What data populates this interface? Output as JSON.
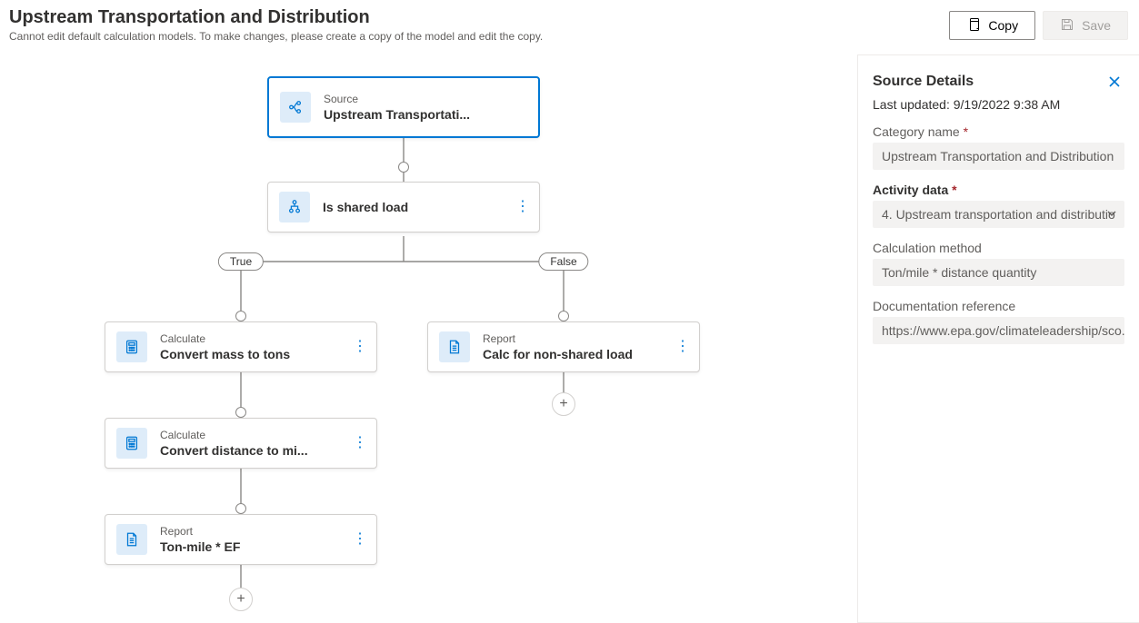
{
  "header": {
    "title": "Upstream Transportation and Distribution",
    "subtitle": "Cannot edit default calculation models. To make changes, please create a copy of the model and edit the copy.",
    "copy_label": "Copy",
    "save_label": "Save"
  },
  "flow": {
    "source": {
      "eyebrow": "Source",
      "label": "Upstream Transportati..."
    },
    "condition": {
      "label": "Is shared load"
    },
    "branch_true": "True",
    "branch_false": "False",
    "true_steps": [
      {
        "eyebrow": "Calculate",
        "label": "Convert mass to tons",
        "icon": "calculator"
      },
      {
        "eyebrow": "Calculate",
        "label": "Convert distance to mi...",
        "icon": "calculator"
      },
      {
        "eyebrow": "Report",
        "label": "Ton-mile * EF",
        "icon": "document"
      }
    ],
    "false_steps": [
      {
        "eyebrow": "Report",
        "label": "Calc for non-shared load",
        "icon": "document"
      }
    ]
  },
  "panel": {
    "title": "Source Details",
    "updated_prefix": "Last updated: ",
    "updated_value": "9/19/2022 9:38 AM",
    "fields": {
      "category_label": "Category name",
      "category_value": "Upstream Transportation and Distribution",
      "activity_label": "Activity data",
      "activity_value": "4. Upstream transportation and distributio",
      "method_label": "Calculation method",
      "method_value": "Ton/mile * distance quantity",
      "docref_label": "Documentation reference",
      "docref_value": "https://www.epa.gov/climateleadership/sco..."
    }
  }
}
